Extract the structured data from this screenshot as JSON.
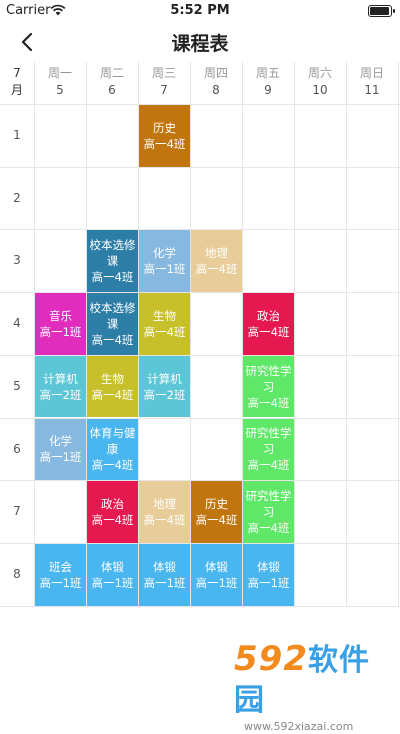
{
  "status_bar": {
    "carrier": "Carrier",
    "time": "5:52 PM",
    "battery_level": 1.0
  },
  "header": {
    "title": "课程表"
  },
  "schedule": {
    "month": "7\n月",
    "days": [
      {
        "name": "周一",
        "date": "5"
      },
      {
        "name": "周二",
        "date": "6"
      },
      {
        "name": "周三",
        "date": "7"
      },
      {
        "name": "周四",
        "date": "8"
      },
      {
        "name": "周五",
        "date": "9"
      },
      {
        "name": "周六",
        "date": "10"
      },
      {
        "name": "周日",
        "date": "11"
      }
    ],
    "periods": [
      "1",
      "2",
      "3",
      "4",
      "5",
      "6",
      "7",
      "8"
    ],
    "courses": [
      {
        "day": 3,
        "period": 1,
        "lines": [
          "历史",
          "高一4班"
        ],
        "color": "#c0750f"
      },
      {
        "day": 2,
        "period": 3,
        "lines": [
          "校本选修",
          "课",
          "高一4班"
        ],
        "color": "#2d7ea6"
      },
      {
        "day": 3,
        "period": 3,
        "lines": [
          "化学",
          "高一1班"
        ],
        "color": "#86b8e0"
      },
      {
        "day": 4,
        "period": 3,
        "lines": [
          "地理",
          "高一4班"
        ],
        "color": "#e8cc9a"
      },
      {
        "day": 1,
        "period": 4,
        "lines": [
          "音乐",
          "高一1班"
        ],
        "color": "#e02dbd"
      },
      {
        "day": 2,
        "period": 4,
        "lines": [
          "校本选修",
          "课",
          "高一4班"
        ],
        "color": "#2d7ea6"
      },
      {
        "day": 3,
        "period": 4,
        "lines": [
          "生物",
          "高一4班"
        ],
        "color": "#c8c02a"
      },
      {
        "day": 5,
        "period": 4,
        "lines": [
          "政治",
          "高一4班"
        ],
        "color": "#e5184f"
      },
      {
        "day": 1,
        "period": 5,
        "lines": [
          "计算机",
          "高一2班"
        ],
        "color": "#5cc6d6"
      },
      {
        "day": 2,
        "period": 5,
        "lines": [
          "生物",
          "高一4班"
        ],
        "color": "#c8c02a"
      },
      {
        "day": 3,
        "period": 5,
        "lines": [
          "计算机",
          "高一2班"
        ],
        "color": "#5cc6d6"
      },
      {
        "day": 5,
        "period": 5,
        "lines": [
          "研究性学",
          "习",
          "高一4班"
        ],
        "color": "#5fe868"
      },
      {
        "day": 1,
        "period": 6,
        "lines": [
          "化学",
          "高一1班"
        ],
        "color": "#86b8e0"
      },
      {
        "day": 2,
        "period": 6,
        "lines": [
          "体育与健",
          "康",
          "高一4班"
        ],
        "color": "#4ab6f0"
      },
      {
        "day": 5,
        "period": 6,
        "lines": [
          "研究性学",
          "习",
          "高一4班"
        ],
        "color": "#5fe868"
      },
      {
        "day": 2,
        "period": 7,
        "lines": [
          "政治",
          "高一4班"
        ],
        "color": "#e5184f"
      },
      {
        "day": 3,
        "period": 7,
        "lines": [
          "地理",
          "高一4班"
        ],
        "color": "#e8cc9a"
      },
      {
        "day": 4,
        "period": 7,
        "lines": [
          "历史",
          "高一4班"
        ],
        "color": "#c0750f"
      },
      {
        "day": 5,
        "period": 7,
        "lines": [
          "研究性学",
          "习",
          "高一4班"
        ],
        "color": "#5fe868"
      },
      {
        "day": 1,
        "period": 8,
        "lines": [
          "班会",
          "高一1班"
        ],
        "color": "#4ab6f0"
      },
      {
        "day": 2,
        "period": 8,
        "lines": [
          "体锻",
          "高一1班"
        ],
        "color": "#4ab6f0"
      },
      {
        "day": 3,
        "period": 8,
        "lines": [
          "体锻",
          "高一1班"
        ],
        "color": "#4ab6f0"
      },
      {
        "day": 4,
        "period": 8,
        "lines": [
          "体锻",
          "高一1班"
        ],
        "color": "#4ab6f0"
      },
      {
        "day": 5,
        "period": 8,
        "lines": [
          "体锻",
          "高一1班"
        ],
        "color": "#4ab6f0"
      }
    ]
  },
  "watermark": {
    "logo_num": "592",
    "logo_cn": "软件园",
    "url": "www.592xiazai.com"
  }
}
